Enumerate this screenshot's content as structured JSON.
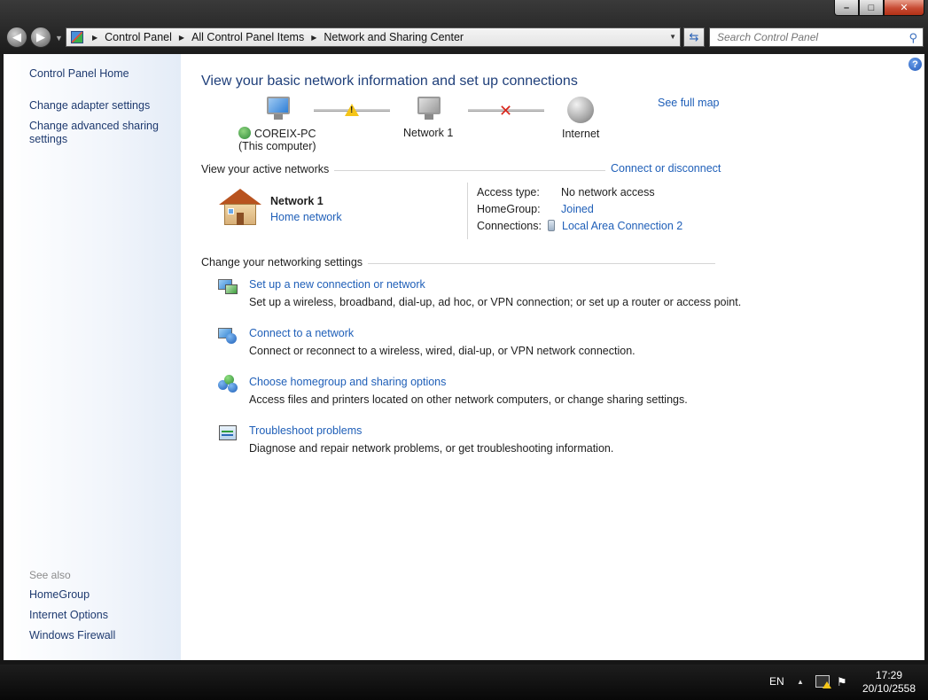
{
  "window": {
    "minimize_label": "–",
    "maximize_label": "□",
    "close_label": "✕"
  },
  "nav": {
    "back_label": "◀",
    "forward_label": "▶",
    "breadcrumbs": [
      "Control Panel",
      "All Control Panel Items",
      "Network and Sharing Center"
    ],
    "search_placeholder": "Search Control Panel"
  },
  "sidebar": {
    "home": "Control Panel Home",
    "adapter": "Change adapter settings",
    "advanced": "Change advanced sharing settings",
    "see_also_title": "See also",
    "see_also": [
      "HomeGroup",
      "Internet Options",
      "Windows Firewall"
    ]
  },
  "main": {
    "title": "View your basic network information and set up connections",
    "see_full_map": "See full map",
    "map": {
      "computer_name": "COREIX-PC",
      "computer_sub": "(This computer)",
      "network_name": "Network  1",
      "internet": "Internet"
    },
    "active": {
      "heading": "View your active networks",
      "connect_link": "Connect or disconnect",
      "network_name": "Network  1",
      "network_type": "Home network",
      "access_type_label": "Access type:",
      "access_type_value": "No network access",
      "homegroup_label": "HomeGroup:",
      "homegroup_value": "Joined",
      "connections_label": "Connections:",
      "connections_value": "Local Area Connection 2"
    },
    "settings": {
      "heading": "Change your networking settings",
      "tasks": [
        {
          "title": "Set up a new connection or network",
          "desc": "Set up a wireless, broadband, dial-up, ad hoc, or VPN connection; or set up a router or access point."
        },
        {
          "title": "Connect to a network",
          "desc": "Connect or reconnect to a wireless, wired, dial-up, or VPN network connection."
        },
        {
          "title": "Choose homegroup and sharing options",
          "desc": "Access files and printers located on other network computers, or change sharing settings."
        },
        {
          "title": "Troubleshoot problems",
          "desc": "Diagnose and repair network problems, or get troubleshooting information."
        }
      ]
    }
  },
  "taskbar": {
    "language": "EN",
    "time": "17:29",
    "date": "20/10/2558"
  }
}
